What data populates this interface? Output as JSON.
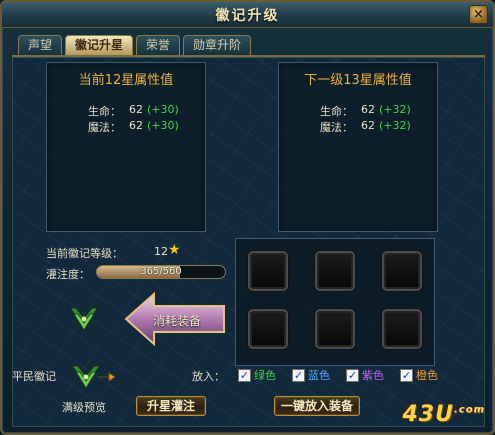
{
  "window": {
    "title": "徽记升级",
    "close_label": "×"
  },
  "tabs": [
    {
      "label": "声望",
      "active": false
    },
    {
      "label": "徽记升星",
      "active": true
    },
    {
      "label": "荣誉",
      "active": false
    },
    {
      "label": "勋章升阶",
      "active": false
    }
  ],
  "current_panel": {
    "title": "当前12星属性值",
    "stats": [
      {
        "label": "生命：",
        "value": "62",
        "bonus": "(+30)"
      },
      {
        "label": "魔法：",
        "value": "62",
        "bonus": "(+30)"
      }
    ]
  },
  "next_panel": {
    "title": "下一级13星属性值",
    "stats": [
      {
        "label": "生命：",
        "value": "62",
        "bonus": "(+32)"
      },
      {
        "label": "魔法：",
        "value": "62",
        "bonus": "(+32)"
      }
    ]
  },
  "emblem_level": {
    "label": "当前徽记等级：",
    "value": "12"
  },
  "infusion": {
    "label": "灌注度：",
    "text": "365/560",
    "current": 365,
    "max": 560
  },
  "consume": {
    "label": "消耗装备"
  },
  "civilian_emblem": {
    "label": "平民徽记"
  },
  "put_in": {
    "label": "放入："
  },
  "filters": [
    {
      "label": "绿色",
      "checked": true,
      "color": "#46d046"
    },
    {
      "label": "蓝色",
      "checked": true,
      "color": "#52a8ff"
    },
    {
      "label": "紫色",
      "checked": true,
      "color": "#c060f0"
    },
    {
      "label": "橙色",
      "checked": true,
      "color": "#ff9a2a"
    }
  ],
  "footer": {
    "preview_label": "满级预览",
    "upgrade_button": "升星灌注",
    "one_click_button": "一键放入装备"
  },
  "watermark": {
    "text": "43U",
    "suffix": ".com"
  },
  "icons": {
    "star": "star-icon",
    "badge": "emblem-icon",
    "arrow": "arrow-left-icon"
  }
}
